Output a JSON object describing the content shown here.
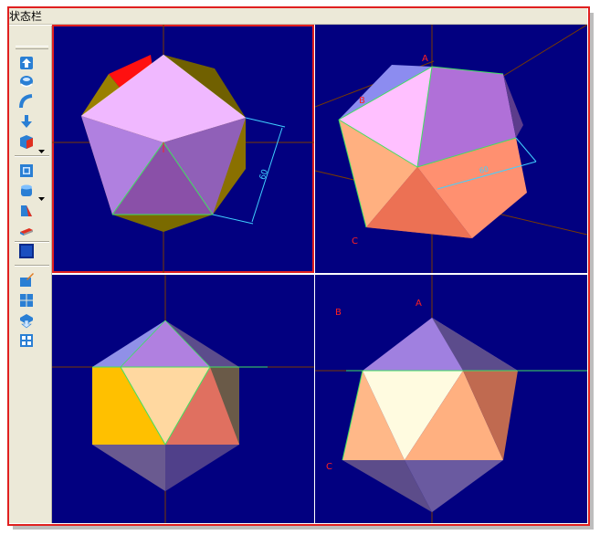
{
  "status_bar": {
    "label": "状态栏"
  },
  "toolbar": {
    "buttons": [
      {
        "icon": "arrow-up-icon"
      },
      {
        "icon": "rotate-icon"
      },
      {
        "icon": "curve-arrow-icon"
      },
      {
        "icon": "arrow-down-icon"
      },
      {
        "icon": "cube-icon"
      },
      {
        "icon": "frame-icon"
      },
      {
        "icon": "cylinder-icon"
      },
      {
        "icon": "wedge-icon"
      },
      {
        "icon": "plane-icon"
      },
      {
        "icon": "solid-box-icon"
      },
      {
        "icon": "pencil-box-icon"
      },
      {
        "icon": "grid-icon"
      },
      {
        "icon": "arrow-down-box-icon"
      },
      {
        "icon": "table-icon"
      }
    ]
  },
  "viewports": {
    "top_left": {
      "dimension_label": "60"
    },
    "top_right": {
      "vertex_labels": [
        "A",
        "B",
        "C"
      ],
      "dimension_label": "60"
    },
    "bottom_right": {
      "vertex_labels": [
        "A",
        "B",
        "C"
      ]
    }
  },
  "colors": {
    "viewport_bg": "#020080",
    "active_border": "#e02020",
    "axis_line": "#7a3a00",
    "edge_green": "#40e060",
    "dimension_cyan": "#40d0ff"
  }
}
